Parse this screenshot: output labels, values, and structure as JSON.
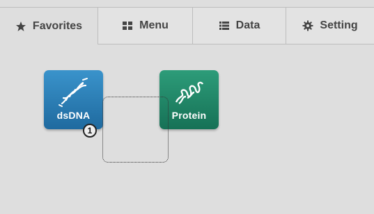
{
  "tabs": [
    {
      "label": "Favorites",
      "icon": "star-icon",
      "active": true
    },
    {
      "label": "Menu",
      "icon": "grid-icon",
      "active": false
    },
    {
      "label": "Data",
      "icon": "list-icon",
      "active": false
    },
    {
      "label": "Setting",
      "icon": "gear-icon",
      "active": false
    }
  ],
  "apps": [
    {
      "label": "dsDNA",
      "icon": "dna-helix-icon",
      "color": "#2b7fb8"
    },
    {
      "label": "Protein",
      "icon": "protein-helix-icon",
      "color": "#21886a"
    }
  ],
  "badge": {
    "value": "1"
  }
}
